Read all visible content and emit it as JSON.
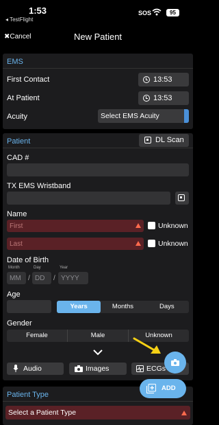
{
  "status": {
    "time": "1:53",
    "back_app": "◂ TestFlight",
    "sos": "SOS",
    "battery": "95"
  },
  "nav": {
    "cancel": "✖Cancel",
    "title": "New Patient"
  },
  "ems": {
    "header": "EMS",
    "first_contact_label": "First Contact",
    "first_contact_time": "13:53",
    "at_patient_label": "At Patient",
    "at_patient_time": "13:53",
    "acuity_label": "Acuity",
    "acuity_value": "Select EMS Acuity"
  },
  "patient": {
    "header": "Patient",
    "dl_scan": "DL Scan",
    "cad_label": "CAD #",
    "wristband_label": "TX EMS Wristband",
    "name_label": "Name",
    "first_placeholder": "First",
    "last_placeholder": "Last",
    "unknown_label": "Unknown",
    "dob_label": "Date of Birth",
    "dob_month_label": "Month",
    "dob_day_label": "Day",
    "dob_year_label": "Year",
    "dob_month_ph": "MM",
    "dob_day_ph": "DD",
    "dob_year_ph": "YYYY",
    "age_label": "Age",
    "age_units": [
      "Years",
      "Months",
      "Days"
    ],
    "gender_label": "Gender",
    "genders": [
      "Female",
      "Male",
      "Unknown"
    ]
  },
  "media": {
    "audio": "Audio",
    "images": "Images",
    "ecgs": "ECGs"
  },
  "fab": {
    "add": "ADD"
  },
  "patient_type": {
    "header": "Patient Type",
    "select": "Select a Patient Type"
  },
  "colors": {
    "accent": "#6ab4ec",
    "error_bg": "#5a2126",
    "warning": "#ff6a4d",
    "arrow": "#f5d015"
  }
}
